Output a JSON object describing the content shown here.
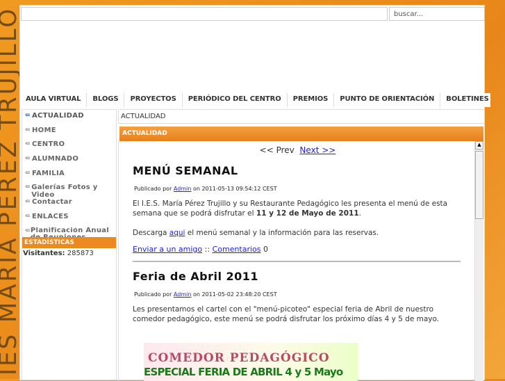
{
  "side_banner": "IES MARÍA PÉREZ TRUJILLO",
  "search": {
    "placeholder": "buscar..."
  },
  "nav": [
    "AULA VIRTUAL",
    "BLOGS",
    "PROYECTOS",
    "PERIÓDICO DEL CENTRO",
    "PREMIOS",
    "PUNTO DE ORIENTACIÓN",
    "BOLETINES"
  ],
  "sidebar": {
    "items": [
      "ACTUALIDAD",
      "HOME",
      "CENTRO",
      "ALUMNADO",
      "FAMILIA",
      "Galerías Fotos y Video",
      "Contactar",
      "ENLACES",
      "Planificación Anual de Reuniones"
    ],
    "stats_title": "ESTADÍSTICAS",
    "visitors_label": "Visitantes:",
    "visitors": "285873"
  },
  "breadcrumb": "ACTUALIDAD",
  "section_title": "ACTUALIDAD",
  "pager": {
    "prev": "<< Prev",
    "next": "Next >>"
  },
  "posts": [
    {
      "title": "MENÚ SEMANAL",
      "by": "Publicado por",
      "author": "Admin",
      "date": "on 2011-05-13 09:54:12 CEST",
      "p1a": "El I.E.S. María Pérez Trujillo y su Restaurante Pedagógico les presenta el menú de esta semana que se podrá disfrutar el ",
      "p1b": "11 y 12 de Mayo de 2011",
      "p1c": ".",
      "p2a": "Descarga ",
      "p2link": "aqui",
      "p2b": " el menú semanal y la información para las reservas.",
      "send": "Enviar a un amigo",
      "sep": " :: ",
      "comments": "Comentarios",
      "count": " 0"
    },
    {
      "title": "Feria de Abril 2011",
      "by": "Publicado por",
      "author": "Admin",
      "date": "on 2011-05-02 23:48:20 CEST",
      "p1": "Les presentamos el cartel con el \"menú-picoteo\" especial feria de Abril de nuestro comedor pedagógico, este menú se podrá disfrutar los próximo días 4 y 5 de mayo.",
      "poster1": "COMEDOR PEDAGÓGICO",
      "poster2": "ESPECIAL FERIA DE ABRIL 4 y 5 Mayo"
    }
  ]
}
